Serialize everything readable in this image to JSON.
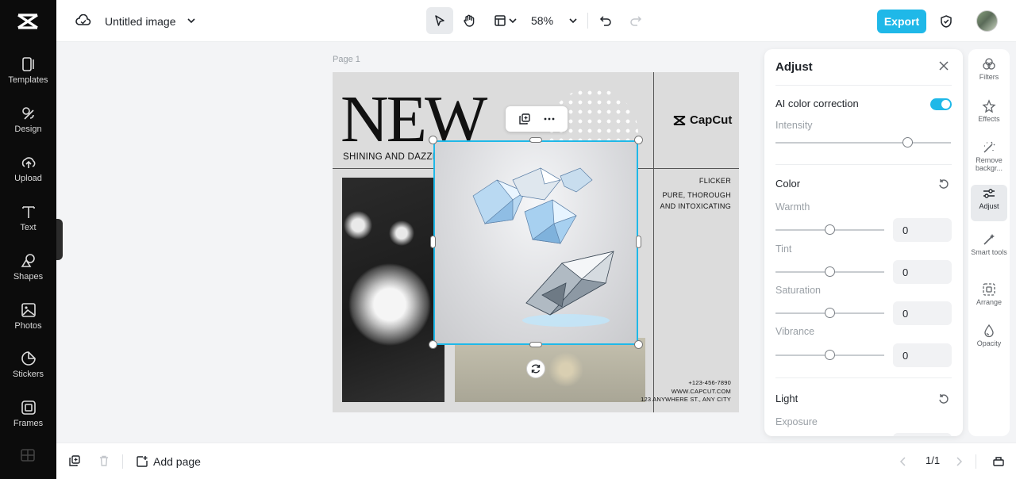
{
  "sidebar": {
    "items": [
      {
        "label": "Templates",
        "icon": "templates-icon"
      },
      {
        "label": "Design",
        "icon": "design-icon"
      },
      {
        "label": "Upload",
        "icon": "upload-icon"
      },
      {
        "label": "Text",
        "icon": "text-icon"
      },
      {
        "label": "Shapes",
        "icon": "shapes-icon"
      },
      {
        "label": "Photos",
        "icon": "photos-icon"
      },
      {
        "label": "Stickers",
        "icon": "stickers-icon"
      },
      {
        "label": "Frames",
        "icon": "frames-icon"
      }
    ]
  },
  "topbar": {
    "title": "Untitled image",
    "zoom": "58%",
    "export_label": "Export"
  },
  "canvas": {
    "page_label": "Page 1",
    "design": {
      "headline": "NEW",
      "tagline": "SHINING AND DAZZLI",
      "brand": "CapCut",
      "flicker": "FLICKER",
      "pure_line1": "PURE, THOROUGH",
      "pure_line2": "AND INTOXICATING",
      "phone": "+123-456-7890",
      "website": "WWW.CAPCUT.COM",
      "address": "123 ANYWHERE ST., ANY CITY"
    }
  },
  "adjust_panel": {
    "title": "Adjust",
    "ai_color_correction": {
      "label": "AI color correction",
      "enabled": true
    },
    "intensity": {
      "label": "Intensity",
      "level": 0.75
    },
    "color": {
      "title": "Color",
      "controls": [
        {
          "label": "Warmth",
          "value": "0"
        },
        {
          "label": "Tint",
          "value": "0"
        },
        {
          "label": "Saturation",
          "value": "0"
        },
        {
          "label": "Vibrance",
          "value": "0"
        }
      ]
    },
    "light": {
      "title": "Light",
      "exposure_label": "Exposure"
    }
  },
  "rail": {
    "items": [
      {
        "label": "Filters",
        "icon": "filters-icon"
      },
      {
        "label": "Effects",
        "icon": "effects-icon"
      },
      {
        "label": "Remove backgr...",
        "icon": "remove-background-icon"
      },
      {
        "label": "Adjust",
        "icon": "adjust-icon",
        "active": true
      },
      {
        "label": "Smart tools",
        "icon": "smart-tools-icon"
      },
      {
        "label": "Arrange",
        "icon": "arrange-icon"
      },
      {
        "label": "Opacity",
        "icon": "opacity-icon"
      }
    ]
  },
  "bottombar": {
    "add_page_label": "Add page",
    "page_counter": "1/1"
  },
  "colors": {
    "accent": "#1fb8e8",
    "sidebar_bg": "#0c0c0c",
    "canvas_bg": "#f3f4f6"
  }
}
